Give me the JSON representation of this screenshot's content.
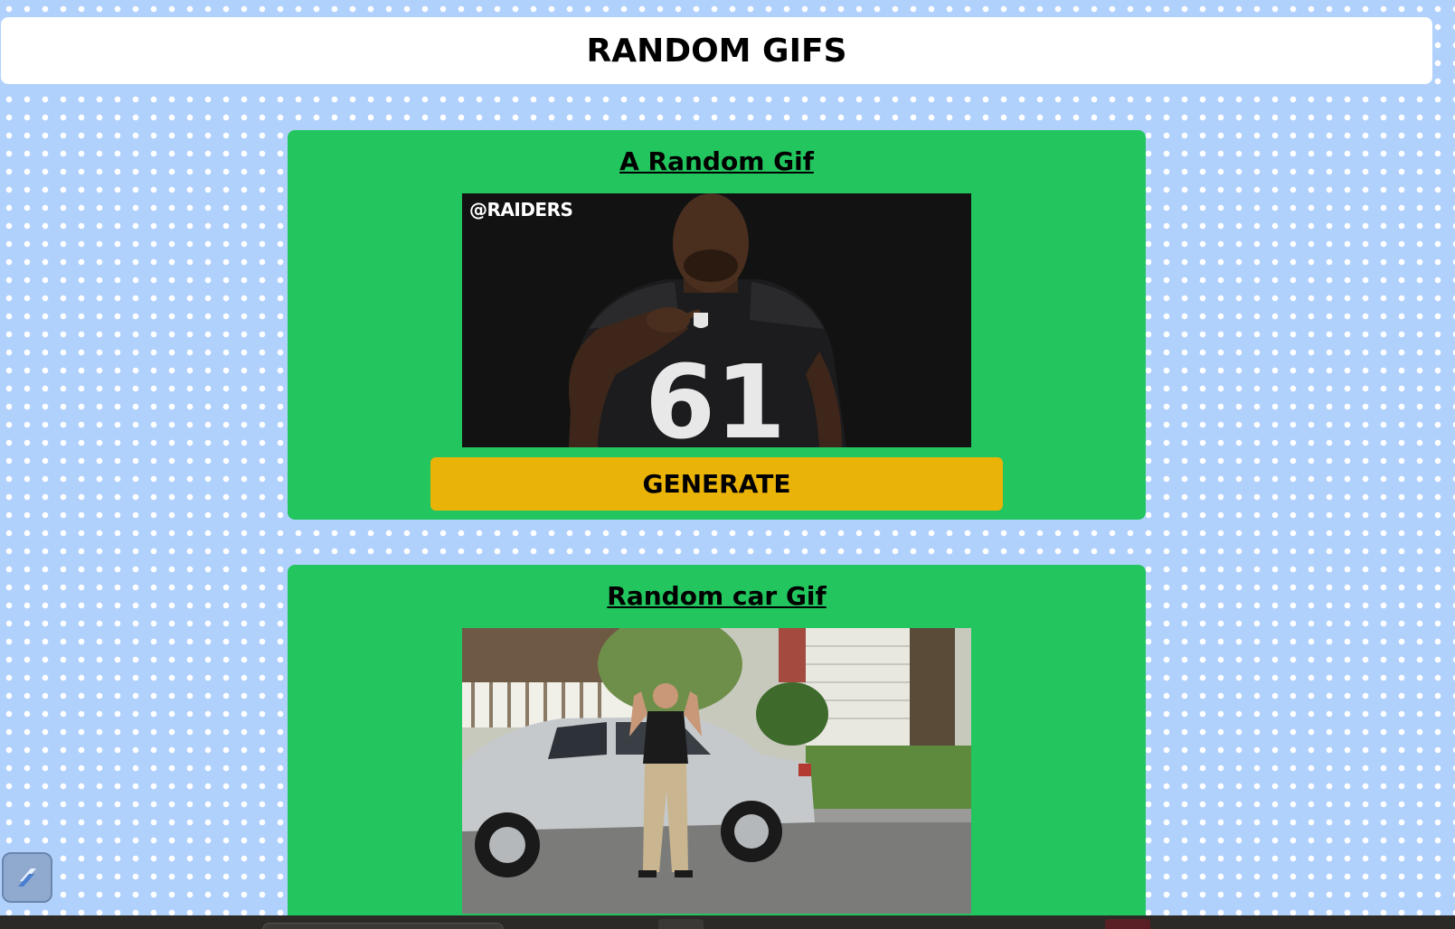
{
  "header": {
    "title": "RANDOM GIFS"
  },
  "cards": [
    {
      "title": "A Random Gif",
      "gif": {
        "watermark": "@RAIDERS",
        "jersey_number": "61"
      },
      "button_label": "GENERATE"
    },
    {
      "title": "Random car Gif",
      "gif": {}
    }
  ],
  "colors": {
    "background": "#b1d1fd",
    "header_bg": "#ffffff",
    "card_bg": "#22c55e",
    "button_bg": "#eab308"
  },
  "icons": {
    "floating_widget": "slash-logo-icon"
  }
}
